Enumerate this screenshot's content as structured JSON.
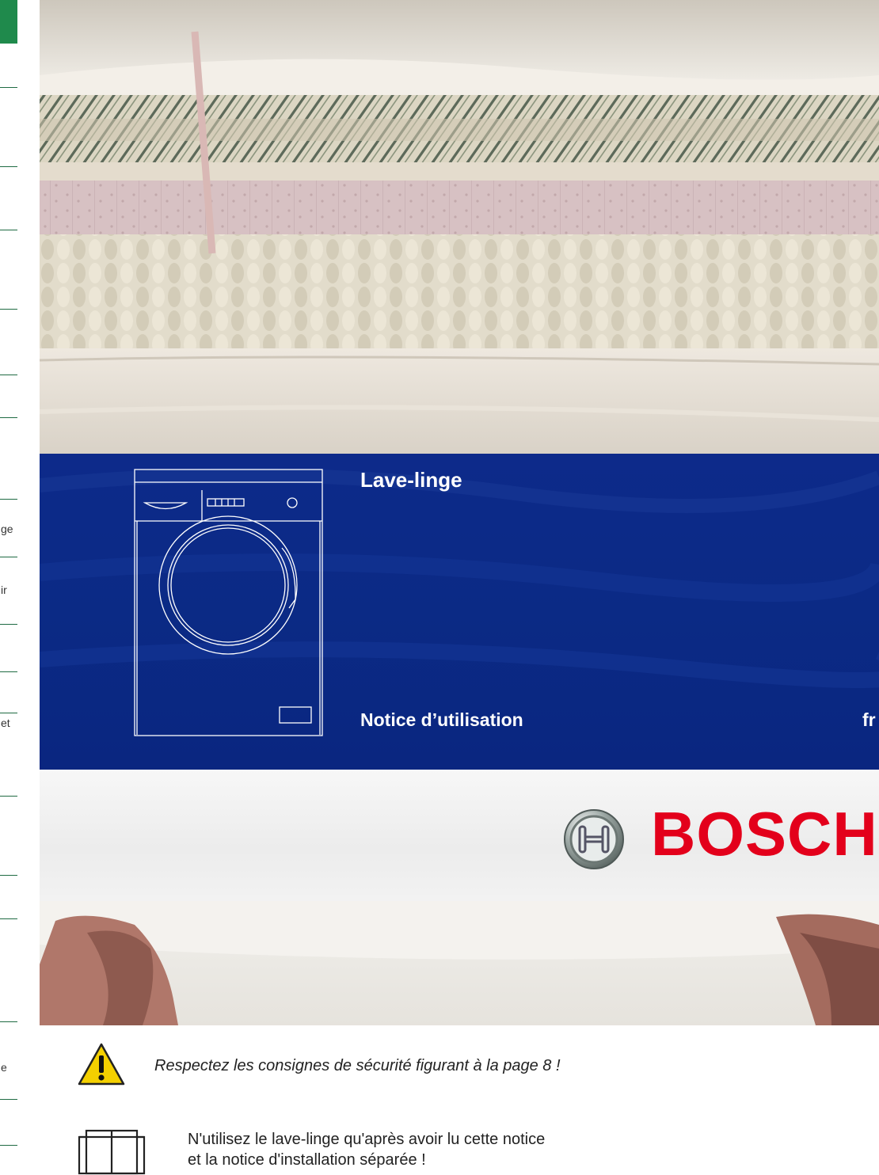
{
  "cover": {
    "product_title": "Lave-linge",
    "doc_type": "Notice d’utilisation",
    "language_code": "fr",
    "brand": "BOSCH"
  },
  "colors": {
    "blue_band": "#0b2a85",
    "brand_red": "#e3001b",
    "index_green": "#1f8a4c"
  },
  "left_index": {
    "fragments": [
      "ge",
      "ir",
      "et",
      "e"
    ]
  },
  "notes": {
    "safety_notice": "Respectez les consignes de sécurité figurant à la page 8 !",
    "read_line1": "N'utilisez le lave-linge qu'après avoir lu cette notice",
    "read_line2": "et la notice d'installation séparée !"
  },
  "icons": {
    "warning": "warning-triangle-icon",
    "manual": "open-book-icon",
    "brand": "bosch-emblem-icon",
    "appliance": "washing-machine-icon"
  }
}
